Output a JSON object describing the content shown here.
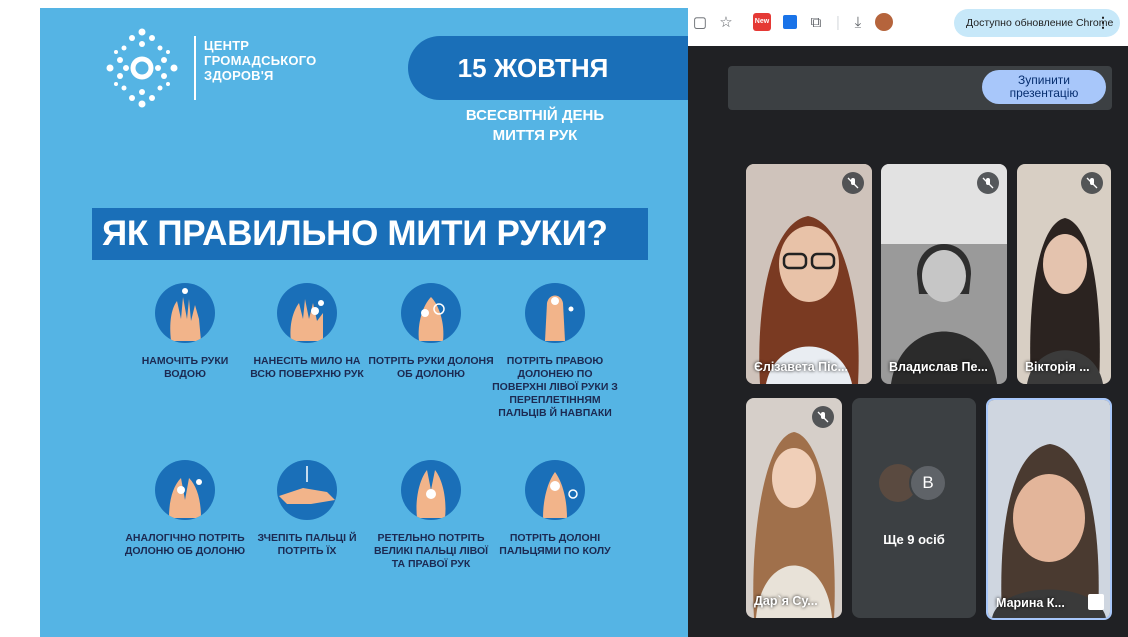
{
  "slide": {
    "org_line1": "ЦЕНТР",
    "org_line2": "ГРОМАДСЬКОГО",
    "org_line3": "ЗДОРОВ'Я",
    "date": "15 ЖОВТНЯ",
    "day_line1": "ВСЕСВІТНІЙ ДЕНЬ",
    "day_line2": "МИТТЯ РУК",
    "headline": "ЯК ПРАВИЛЬНО МИТИ РУКИ?",
    "steps": [
      "НАМОЧІТЬ РУКИ ВОДОЮ",
      "НАНЕСІТЬ МИЛО НА ВСЮ ПОВЕРХНЮ РУК",
      "ПОТРІТЬ РУКИ ДОЛОНЯ ОБ ДОЛОНЮ",
      "ПОТРІТЬ ПРАВОЮ ДОЛОНЕЮ ПО ПОВЕРХНІ ЛІВОЇ РУКИ З ПЕРЕПЛЕТІННЯМ ПАЛЬЦІВ Й НАВПАКИ",
      "АНАЛОГІЧНО ПОТРІТЬ ДОЛОНЮ ОБ ДОЛОНЮ",
      "ЗЧЕПІТЬ ПАЛЬЦІ Й ПОТРІТЬ ЇХ",
      "РЕТЕЛЬНО ПОТРІТЬ ВЕЛИКІ ПАЛЬЦІ ЛІВОЇ ТА ПРАВОЇ РУК",
      "ПОТРІТЬ ДОЛОНІ ПАЛЬЦЯМИ ПО КОЛУ"
    ]
  },
  "browser": {
    "update_label": "Доступно обновление Chrome",
    "menu_dots": "⋮",
    "new_badge": "New"
  },
  "meet": {
    "stop_presenting": "Зупинити презентацію",
    "participants": [
      {
        "name": "Єлізавета Піс..."
      },
      {
        "name": "Владислав Пе..."
      },
      {
        "name": "Вікторія ..."
      },
      {
        "name": "Дар`я Су..."
      },
      {
        "name": "Марина К..."
      }
    ],
    "more_label": "Ще 9 осіб",
    "more_avatar_letter": "В"
  },
  "colors": {
    "slide_bg": "#55b4e4",
    "slide_accent": "#1a6fb8",
    "meet_bg": "#202124",
    "button_blue": "#a8c7fa"
  }
}
